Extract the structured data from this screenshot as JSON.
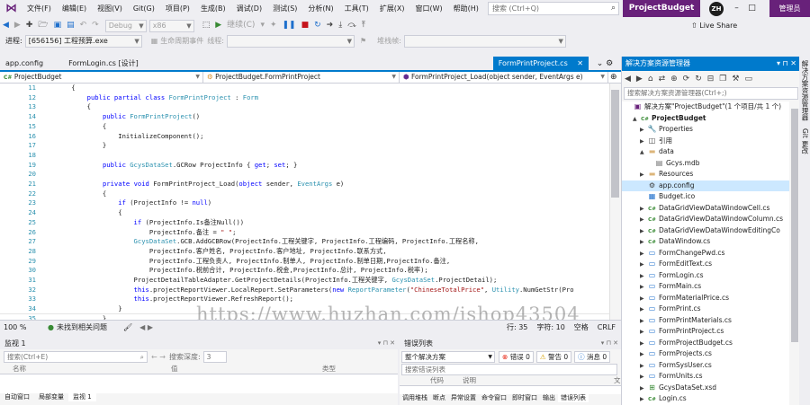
{
  "menubar": {
    "items": [
      "文件(F)",
      "编辑(E)",
      "视图(V)",
      "Git(G)",
      "项目(P)",
      "生成(B)",
      "调试(D)",
      "测试(S)",
      "分析(N)",
      "工具(T)",
      "扩展(X)",
      "窗口(W)",
      "帮助(H)"
    ],
    "search_placeholder": "搜索 (Ctrl+Q)",
    "solution_name": "ProjectBudget",
    "avatar_initials": "ZH",
    "mgmt_button": "管理员"
  },
  "toolbar": {
    "config": "Debug",
    "platform": "x86",
    "continue_label": "继续(C)",
    "live_share": "Live Share"
  },
  "process_bar": {
    "process_label": "进程:",
    "process_value": "[656156] 工程预算.exe",
    "lifecycle_label": "生命周期事件",
    "thread_label": "线程:",
    "stack_label": "堆栈帧:"
  },
  "doc_tabs": [
    "app.config",
    "FormLogin.cs [设计]"
  ],
  "active_tab": "FormPrintProject.cs",
  "nav_bar": {
    "project": "ProjectBudget",
    "class": "ProjectBudget.FormPrintProject",
    "member": "FormPrintProject_Load(object sender, EventArgs e)"
  },
  "code_lines": [
    {
      "n": "11",
      "t": "    {"
    },
    {
      "n": "12",
      "t": "        public partial class FormPrintProject : Form"
    },
    {
      "n": "13",
      "t": "        {"
    },
    {
      "n": "14",
      "t": "            public FormPrintProject()"
    },
    {
      "n": "15",
      "t": "            {"
    },
    {
      "n": "16",
      "t": "                InitializeComponent();"
    },
    {
      "n": "17",
      "t": "            }"
    },
    {
      "n": "18",
      "t": ""
    },
    {
      "n": "19",
      "t": "            public GcysDataSet.GCRow ProjectInfo { get; set; }"
    },
    {
      "n": "20",
      "t": ""
    },
    {
      "n": "21",
      "t": "            private void FormPrintProject_Load(object sender, EventArgs e)"
    },
    {
      "n": "22",
      "t": "            {"
    },
    {
      "n": "23",
      "t": "                if (ProjectInfo != null)"
    },
    {
      "n": "24",
      "t": "                {"
    },
    {
      "n": "25",
      "t": "                    if (ProjectInfo.Is备注Null())"
    },
    {
      "n": "26",
      "t": "                        ProjectInfo.备注 = \" \";"
    },
    {
      "n": "27",
      "t": "                    GcysDataSet.GCB.AddGCBRow(ProjectInfo.工程关键字, ProjectInfo.工程编码, ProjectInfo.工程名称,"
    },
    {
      "n": "28",
      "t": "                        ProjectInfo.客户姓名, ProjectInfo.客户地址, ProjectInfo.联系方式,"
    },
    {
      "n": "29",
      "t": "                        ProjectInfo.工程负责人, ProjectInfo.制单人, ProjectInfo.制单日期,ProjectInfo.备注,"
    },
    {
      "n": "30",
      "t": "                        ProjectInfo.税前合计, ProjectInfo.税金,ProjectInfo.总计, ProjectInfo.税率);"
    },
    {
      "n": "31",
      "t": "                    ProjectDetailTableAdapter.GetProjectDetails(ProjectInfo.工程关键字, GcysDataSet.ProjectDetail);"
    },
    {
      "n": "32",
      "t": "                    this.projectReportViewer.LocalReport.SetParameters(new ReportParameter(\"ChineseTotalPrice\", Utility.NumGetStr(Pro"
    },
    {
      "n": "33",
      "t": "                    this.projectReportViewer.RefreshReport();"
    },
    {
      "n": "34",
      "t": "                }"
    },
    {
      "n": "35",
      "t": "            }"
    },
    {
      "n": "36",
      "t": "        }"
    }
  ],
  "watermark": "https://www.huzhan.com/ishop43504",
  "editor_status": {
    "zoom": "100 %",
    "issues": "未找到相关问题",
    "line": "行: 35",
    "col": "字符: 10",
    "spaces": "空格",
    "eol": "CRLF"
  },
  "watch_panel": {
    "title": "监视 1",
    "search_placeholder": "搜索(Ctrl+E)",
    "depth_label": "搜索深度:",
    "depth_value": "3",
    "col_name": "名称",
    "col_value": "值",
    "col_type": "类型",
    "bottom_tabs": [
      "自动窗口",
      "局部变量",
      "监视 1"
    ]
  },
  "error_panel": {
    "title": "错误列表",
    "scope": "整个解决方案",
    "errors": "错误 0",
    "warnings": "警告 0",
    "messages": "消息 0",
    "search_placeholder": "搜索错误列表",
    "col_code": "代码",
    "col_desc": "说明",
    "col_file": "文",
    "bottom_tabs": [
      "调用堆栈",
      "断点",
      "异常设置",
      "命令窗口",
      "即时窗口",
      "输出",
      "错误列表"
    ]
  },
  "solution_explorer": {
    "title": "解决方案资源管理器",
    "search_placeholder": "搜索解决方案资源管理器(Ctrl+;)",
    "items": [
      {
        "label": "解决方案\"ProjectBudget\"(1 个项目/共 1 个)",
        "depth": 0,
        "icon": "solution-icon",
        "expander": ""
      },
      {
        "label": "ProjectBudget",
        "depth": 1,
        "icon": "csproj-icon",
        "expander": "▲",
        "bold": true
      },
      {
        "label": "Properties",
        "depth": 2,
        "icon": "wrench-icon",
        "expander": "▶"
      },
      {
        "label": "引用",
        "depth": 2,
        "icon": "references-icon",
        "expander": "▶"
      },
      {
        "label": "data",
        "depth": 2,
        "icon": "folder-icon",
        "expander": "▲"
      },
      {
        "label": "Gcys.mdb",
        "depth": 3,
        "icon": "database-icon",
        "expander": ""
      },
      {
        "label": "Resources",
        "depth": 2,
        "icon": "folder-icon",
        "expander": "▶"
      },
      {
        "label": "app.config",
        "depth": 2,
        "icon": "config-icon",
        "expander": "",
        "selected": true
      },
      {
        "label": "Budget.ico",
        "depth": 2,
        "icon": "ico-icon",
        "expander": ""
      },
      {
        "label": "DataGridViewDataWindowCell.cs",
        "depth": 2,
        "icon": "cs-icon",
        "expander": "▶"
      },
      {
        "label": "DataGridViewDataWindowColumn.cs",
        "depth": 2,
        "icon": "cs-icon",
        "expander": "▶"
      },
      {
        "label": "DataGridViewDataWindowEditingCo",
        "depth": 2,
        "icon": "cs-icon",
        "expander": "▶"
      },
      {
        "label": "DataWindow.cs",
        "depth": 2,
        "icon": "cs-icon",
        "expander": "▶"
      },
      {
        "label": "FormChangePwd.cs",
        "depth": 2,
        "icon": "form-icon",
        "expander": "▶"
      },
      {
        "label": "FormEditText.cs",
        "depth": 2,
        "icon": "form-icon",
        "expander": "▶"
      },
      {
        "label": "FormLogin.cs",
        "depth": 2,
        "icon": "form-icon",
        "expander": "▶"
      },
      {
        "label": "FormMain.cs",
        "depth": 2,
        "icon": "form-icon",
        "expander": "▶"
      },
      {
        "label": "FormMaterialPrice.cs",
        "depth": 2,
        "icon": "form-icon",
        "expander": "▶"
      },
      {
        "label": "FormPrint.cs",
        "depth": 2,
        "icon": "form-icon",
        "expander": "▶"
      },
      {
        "label": "FormPrintMaterials.cs",
        "depth": 2,
        "icon": "form-icon",
        "expander": "▶"
      },
      {
        "label": "FormPrintProject.cs",
        "depth": 2,
        "icon": "form-icon",
        "expander": "▶"
      },
      {
        "label": "FormProjectBudget.cs",
        "depth": 2,
        "icon": "form-icon",
        "expander": "▶"
      },
      {
        "label": "FormProjects.cs",
        "depth": 2,
        "icon": "form-icon",
        "expander": "▶"
      },
      {
        "label": "FormSysUser.cs",
        "depth": 2,
        "icon": "form-icon",
        "expander": "▶"
      },
      {
        "label": "FormUnits.cs",
        "depth": 2,
        "icon": "form-icon",
        "expander": "▶"
      },
      {
        "label": "GcysDataSet.xsd",
        "depth": 2,
        "icon": "xsd-icon",
        "expander": "▶"
      },
      {
        "label": "Login.cs",
        "depth": 2,
        "icon": "cs-icon",
        "expander": "▶"
      }
    ]
  },
  "right_strip": {
    "labels": [
      "解决方案资源管理器",
      "Git 更改"
    ]
  },
  "colors": {
    "accent": "#007acc",
    "brand": "#68217a",
    "selection": "#cce8ff",
    "line_number": "#2b91af"
  }
}
